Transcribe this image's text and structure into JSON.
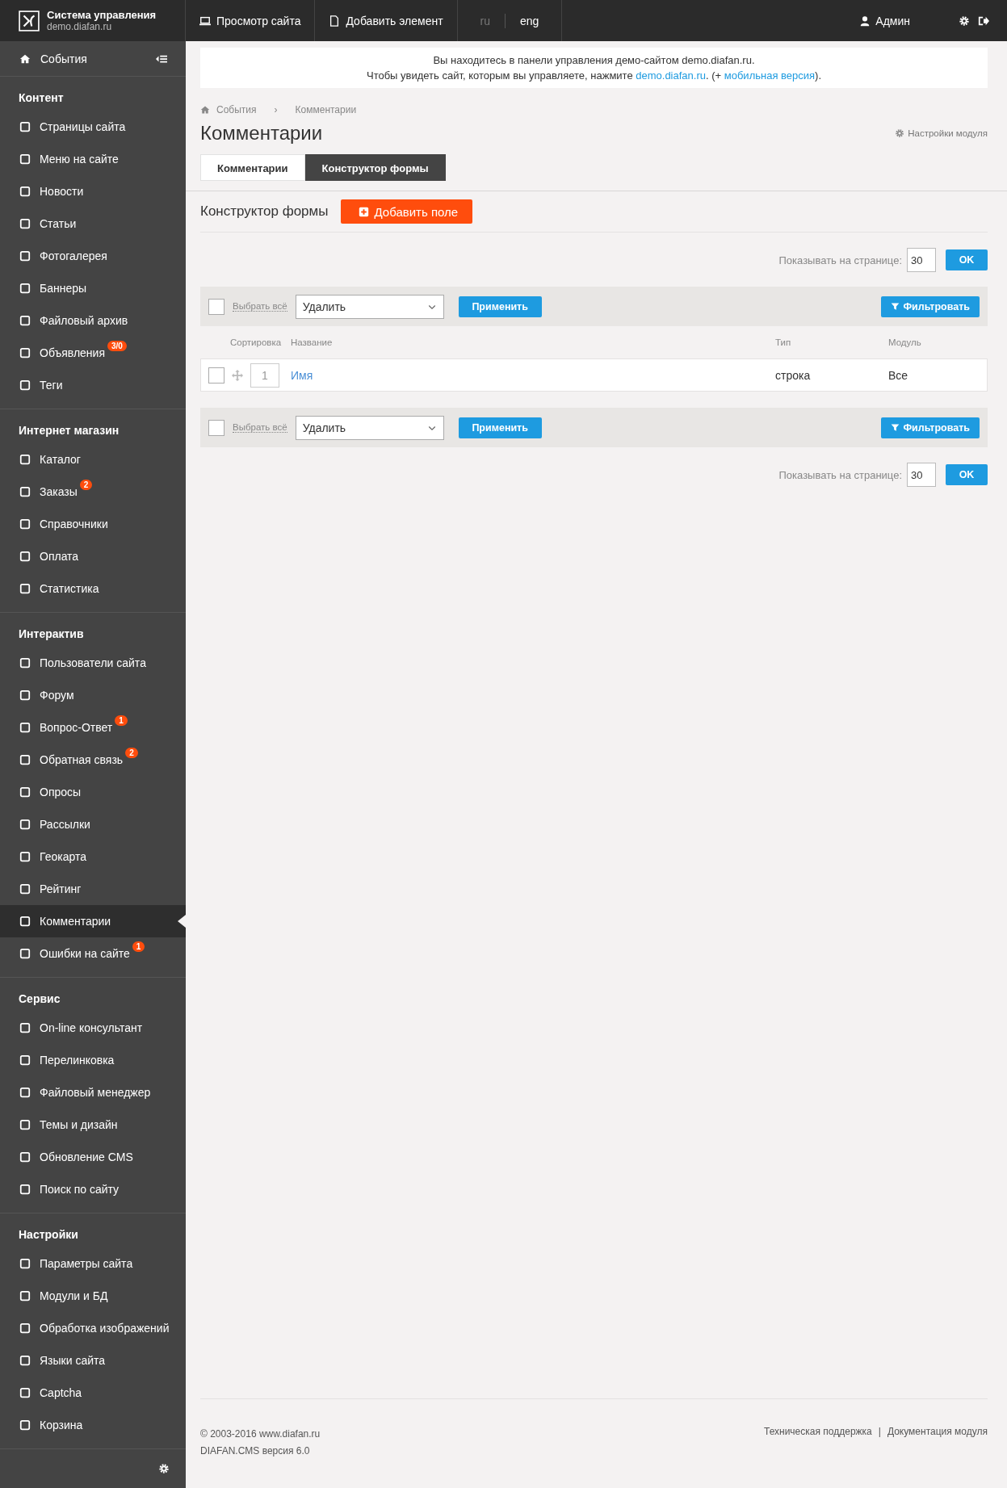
{
  "topbar": {
    "brand_title": "Система управления",
    "brand_subtitle": "demo.diafan.ru",
    "links": [
      {
        "label": "Просмотр сайта",
        "kind": "monitor"
      },
      {
        "label": "Добавить элемент",
        "kind": "document"
      }
    ],
    "languages": [
      {
        "label": "ru",
        "selected": false
      },
      {
        "label": "eng",
        "selected": true
      }
    ],
    "user": "Админ"
  },
  "sidebar": {
    "top_item": "События",
    "sections": [
      {
        "title": "Контент",
        "items": [
          {
            "label": "Страницы сайта",
            "selected": false
          },
          {
            "label": "Меню на сайте",
            "selected": false
          },
          {
            "label": "Новости",
            "selected": false
          },
          {
            "label": "Статьи",
            "selected": false
          },
          {
            "label": "Фотогалерея",
            "selected": false
          },
          {
            "label": "Баннеры",
            "selected": false
          },
          {
            "label": "Файловый архив",
            "selected": false
          },
          {
            "label": "Объявления",
            "selected": false,
            "badge": "3/0"
          },
          {
            "label": "Теги",
            "selected": false
          }
        ]
      },
      {
        "title": "Интернет магазин",
        "items": [
          {
            "label": "Каталог",
            "selected": false
          },
          {
            "label": "Заказы",
            "selected": false,
            "badge": "2"
          },
          {
            "label": "Справочники",
            "selected": false
          },
          {
            "label": "Оплата",
            "selected": false
          },
          {
            "label": "Статистика",
            "selected": false
          }
        ]
      },
      {
        "title": "Интерактив",
        "items": [
          {
            "label": "Пользователи сайта",
            "selected": false
          },
          {
            "label": "Форум",
            "selected": false
          },
          {
            "label": "Вопрос-Ответ",
            "selected": false,
            "badge": "1"
          },
          {
            "label": "Обратная связь",
            "selected": false,
            "badge": "2"
          },
          {
            "label": "Опросы",
            "selected": false
          },
          {
            "label": "Рассылки",
            "selected": false
          },
          {
            "label": "Геокарта",
            "selected": false
          },
          {
            "label": "Рейтинг",
            "selected": false
          },
          {
            "label": "Комментарии",
            "selected": true
          },
          {
            "label": "Ошибки на сайте",
            "selected": false,
            "badge": "1"
          }
        ]
      },
      {
        "title": "Сервис",
        "items": [
          {
            "label": "On-line консультант",
            "selected": false
          },
          {
            "label": "Перелинковка",
            "selected": false
          },
          {
            "label": "Файловый менеджер",
            "selected": false
          },
          {
            "label": "Темы и дизайн",
            "selected": false
          },
          {
            "label": "Обновление CMS",
            "selected": false
          },
          {
            "label": "Поиск по сайту",
            "selected": false
          }
        ]
      },
      {
        "title": "Настройки",
        "items": [
          {
            "label": "Параметры сайта",
            "selected": false
          },
          {
            "label": "Модули и БД",
            "selected": false
          },
          {
            "label": "Обработка изображений",
            "selected": false
          },
          {
            "label": "Языки сайта",
            "selected": false
          },
          {
            "label": "Captcha",
            "selected": false
          },
          {
            "label": "Корзина",
            "selected": false
          }
        ]
      }
    ]
  },
  "notice": {
    "line1": "Вы находитесь в панели управления демо-сайтом demo.diafan.ru.",
    "line2_before": "Чтобы увидеть сайт, которым вы управляете, нажмите ",
    "link1": "demo.diafan.ru",
    "between": ". (+ ",
    "link2": "мобильная версия",
    "after": ")."
  },
  "breadcrumb": {
    "items": [
      "События",
      "Комментарии"
    ],
    "separator": "›"
  },
  "title": "Комментарии",
  "settings_link": "Настройки модуля",
  "tabs": [
    {
      "label": "Комментарии",
      "selected": false
    },
    {
      "label": "Конструктор формы",
      "selected": true
    }
  ],
  "section_title": "Конструктор формы",
  "add_button": "Добавить поле",
  "pager_top": {
    "label": "Показывать на странице:",
    "value": "30",
    "button": "OK"
  },
  "toolbar_top": {
    "checked": false,
    "select_all": "Выбрать всё",
    "action": "Удалить",
    "apply": "Применить",
    "filter": "Фильтровать"
  },
  "table": {
    "columns": [
      "Сортировка",
      "Название",
      "Тип",
      "Модуль"
    ],
    "rows": [
      {
        "checked": false,
        "sort": "1",
        "name": "Имя",
        "type": "строка",
        "module": "Все"
      }
    ]
  },
  "toolbar_bottom": {
    "checked": false,
    "select_all": "Выбрать всё",
    "action": "Удалить",
    "apply": "Применить",
    "filter": "Фильтровать"
  },
  "pager_bottom": {
    "label": "Показывать на странице:",
    "value": "30",
    "button": "OK"
  },
  "footer": {
    "copyright": "© 2003-2016 www.diafan.ru",
    "version": "DIAFAN.CMS версия 6.0",
    "links": [
      "Техническая поддержка",
      "Документация модуля"
    ],
    "separator": "|"
  }
}
